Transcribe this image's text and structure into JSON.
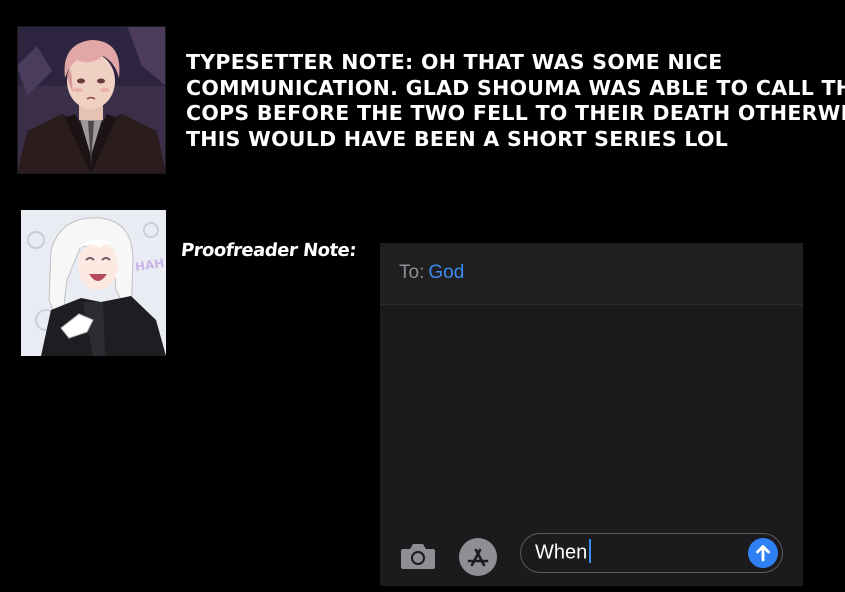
{
  "typesetter": {
    "avatar_icon": "typesetter-avatar",
    "note_lines": [
      "TYPESETTER NOTE: OH THAT WAS SOME NICE",
      "COMMUNICATION. GLAD SHOUMA WAS ABLE TO CALL THE",
      "COPS BEFORE THE TWO FELL TO THEIR DEATH OTHERWISE",
      "THIS WOULD HAVE BEEN A SHORT SERIES LOL"
    ]
  },
  "proofreader": {
    "avatar_icon": "proofreader-avatar",
    "avatar_caption": "HAH",
    "label": "Proofreader Note:"
  },
  "messages": {
    "to_label": "To:",
    "recipient": "God",
    "draft_text": "When",
    "camera_icon": "camera-icon",
    "appstore_icon": "app-store-icon",
    "send_icon": "send-arrow-icon",
    "colors": {
      "background": "#1b1b1d",
      "recipient": "#3a8cf0",
      "send_button": "#2f7ff5"
    }
  }
}
